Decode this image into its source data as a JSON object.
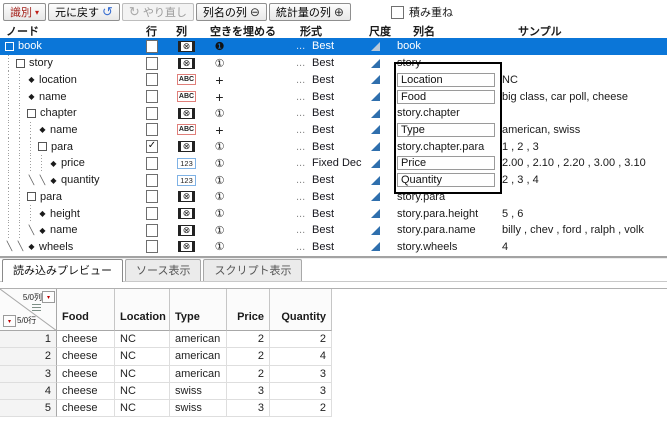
{
  "toolbar": {
    "identify_label": "識別",
    "undo_label": "元に戻す",
    "redo_label": "やり直し",
    "colname_col_label": "列名の列",
    "stat_col_label": "統計量の列",
    "stack_label": "積み重ね"
  },
  "icons": {
    "identify_caret": "▾",
    "undo": "↺",
    "redo": "↻",
    "minus_circle": "⊖",
    "plus_circle": "⊕",
    "excluded": "⊗",
    "abc": "ABC",
    "num": "123",
    "circled_one": "①",
    "circled_one_filled": "❶",
    "plus_fill": "+",
    "check": "✓",
    "leaf_diamond": "◆",
    "branch": "╲",
    "red_caret": "▾"
  },
  "tree": {
    "headers": {
      "node": "ノード",
      "row": "行",
      "col": "列",
      "fill": "空きを埋める",
      "format": "形式",
      "scale": "尺度",
      "colname": "列名",
      "sample": "サンプル"
    },
    "rows": [
      {
        "name": "book",
        "kind": "container",
        "guides": [],
        "checked": false,
        "col_icon": "none",
        "fill": "one-filled",
        "format": "Best",
        "colname": "book",
        "editable": false,
        "sample": "",
        "selected": true
      },
      {
        "name": "story",
        "kind": "container",
        "guides": [
          "d"
        ],
        "checked": false,
        "col_icon": "none",
        "fill": "one",
        "format": "Best",
        "colname": "story",
        "editable": false,
        "sample": "",
        "selected": false
      },
      {
        "name": "location",
        "kind": "leaf",
        "guides": [
          "d",
          "d"
        ],
        "checked": false,
        "col_icon": "abc",
        "fill": "plus",
        "format": "Best",
        "colname": "Location",
        "editable": true,
        "sample": "NC",
        "selected": false
      },
      {
        "name": "name",
        "kind": "leaf",
        "guides": [
          "d",
          "d"
        ],
        "checked": false,
        "col_icon": "abc",
        "fill": "plus",
        "format": "Best",
        "colname": "Food",
        "editable": true,
        "sample": "big class, car poll, cheese",
        "selected": false
      },
      {
        "name": "chapter",
        "kind": "container",
        "guides": [
          "d",
          "d"
        ],
        "checked": false,
        "col_icon": "none",
        "fill": "one",
        "format": "Best",
        "colname": "story.chapter",
        "editable": false,
        "sample": "",
        "selected": false
      },
      {
        "name": "name",
        "kind": "leaf",
        "guides": [
          "d",
          "d",
          "d"
        ],
        "checked": false,
        "col_icon": "abc",
        "fill": "plus",
        "format": "Best",
        "colname": "Type",
        "editable": true,
        "sample": "american, swiss",
        "selected": false
      },
      {
        "name": "para",
        "kind": "container",
        "guides": [
          "d",
          "d",
          "d"
        ],
        "checked": true,
        "col_icon": "none",
        "fill": "one",
        "format": "Best",
        "colname": "story.chapter.para",
        "editable": false,
        "sample": "1 , 2 , 3",
        "selected": false
      },
      {
        "name": "price",
        "kind": "leaf",
        "guides": [
          "d",
          "d",
          "d",
          "d"
        ],
        "checked": false,
        "col_icon": "num",
        "fill": "one",
        "format": "Fixed Dec",
        "colname": "Price",
        "editable": true,
        "sample": "2.00 , 2.10 , 2.20 , 3.00 , 3.10",
        "selected": false
      },
      {
        "name": "quantity",
        "kind": "leaf",
        "guides": [
          "d",
          "d",
          "s",
          "s"
        ],
        "checked": false,
        "col_icon": "num",
        "fill": "one",
        "format": "Best",
        "colname": "Quantity",
        "editable": true,
        "sample": "2 , 3 , 4",
        "selected": false
      },
      {
        "name": "para",
        "kind": "container",
        "guides": [
          "d",
          "d"
        ],
        "checked": false,
        "col_icon": "none",
        "fill": "one",
        "format": "Best",
        "colname": "story.para",
        "editable": false,
        "sample": "",
        "selected": false
      },
      {
        "name": "height",
        "kind": "leaf",
        "guides": [
          "d",
          "d",
          "d"
        ],
        "checked": false,
        "col_icon": "none",
        "fill": "one",
        "format": "Best",
        "colname": "story.para.height",
        "editable": false,
        "sample": "5 , 6",
        "selected": false
      },
      {
        "name": "name",
        "kind": "leaf",
        "guides": [
          "d",
          "d",
          "s"
        ],
        "checked": false,
        "col_icon": "none",
        "fill": "one",
        "format": "Best",
        "colname": "story.para.name",
        "editable": false,
        "sample": "billy , chev , ford , ralph , volk",
        "selected": false
      },
      {
        "name": "wheels",
        "kind": "leaf",
        "guides": [
          "s",
          "s"
        ],
        "checked": false,
        "col_icon": "none",
        "fill": "one",
        "format": "Best",
        "colname": "story.wheels",
        "editable": false,
        "sample": "4",
        "selected": false
      }
    ]
  },
  "tabs": [
    {
      "label": "読み込みプレビュー",
      "active": true
    },
    {
      "label": "ソース表示",
      "active": false
    },
    {
      "label": "スクリプト表示",
      "active": false
    }
  ],
  "preview": {
    "corner": {
      "cols": "5/0列",
      "rows": "5/0行"
    },
    "columns": [
      "Food",
      "Location",
      "Type",
      "Price",
      "Quantity"
    ],
    "rows": [
      [
        "cheese",
        "NC",
        "american",
        "2",
        "2"
      ],
      [
        "cheese",
        "NC",
        "american",
        "2",
        "4"
      ],
      [
        "cheese",
        "NC",
        "american",
        "2",
        "3"
      ],
      [
        "cheese",
        "NC",
        "swiss",
        "3",
        "3"
      ],
      [
        "cheese",
        "NC",
        "swiss",
        "3",
        "2"
      ]
    ]
  },
  "colors": {
    "selection_blue": "#0b76d8",
    "abc_icon_border": "#e07f7a",
    "num_icon_border": "#7fb2e5",
    "scale_triangle": "#2f6fad",
    "accent_red": "#c00000",
    "identify_red": "#a5231d"
  }
}
